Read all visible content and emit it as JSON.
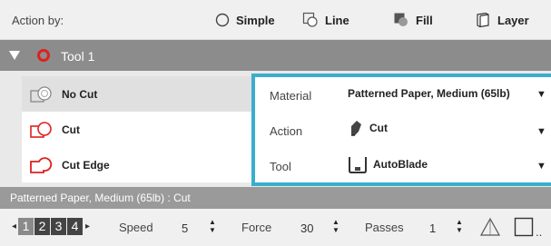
{
  "toolbar": {
    "action_by_label": "Action by:",
    "modes": [
      {
        "label": "Simple",
        "icon": "circle-outline-icon"
      },
      {
        "label": "Line",
        "icon": "line-shape-icon"
      },
      {
        "label": "Fill",
        "icon": "fill-shape-icon"
      },
      {
        "label": "Layer",
        "icon": "layer-book-icon"
      }
    ]
  },
  "tool": {
    "name": "Tool 1",
    "color": "#e02020"
  },
  "cut_options": [
    {
      "label": "No Cut",
      "selected": true
    },
    {
      "label": "Cut",
      "selected": false
    },
    {
      "label": "Cut Edge",
      "selected": false
    }
  ],
  "properties": {
    "material_label": "Material",
    "material_value": "Patterned Paper, Medium (65lb)",
    "action_label": "Action",
    "action_value": "Cut",
    "tool_label": "Tool",
    "tool_value": "AutoBlade"
  },
  "status_text": "Patterned Paper, Medium (65lb) : Cut",
  "bottom": {
    "sequence": [
      "1",
      "2",
      "3",
      "4"
    ],
    "speed_label": "Speed",
    "speed_value": "5",
    "force_label": "Force",
    "force_value": "30",
    "passes_label": "Passes",
    "passes_value": "1"
  },
  "colors": {
    "accent_border": "#3aaecc",
    "cut_red": "#e02020",
    "tool_header": "#8c8c8c"
  }
}
